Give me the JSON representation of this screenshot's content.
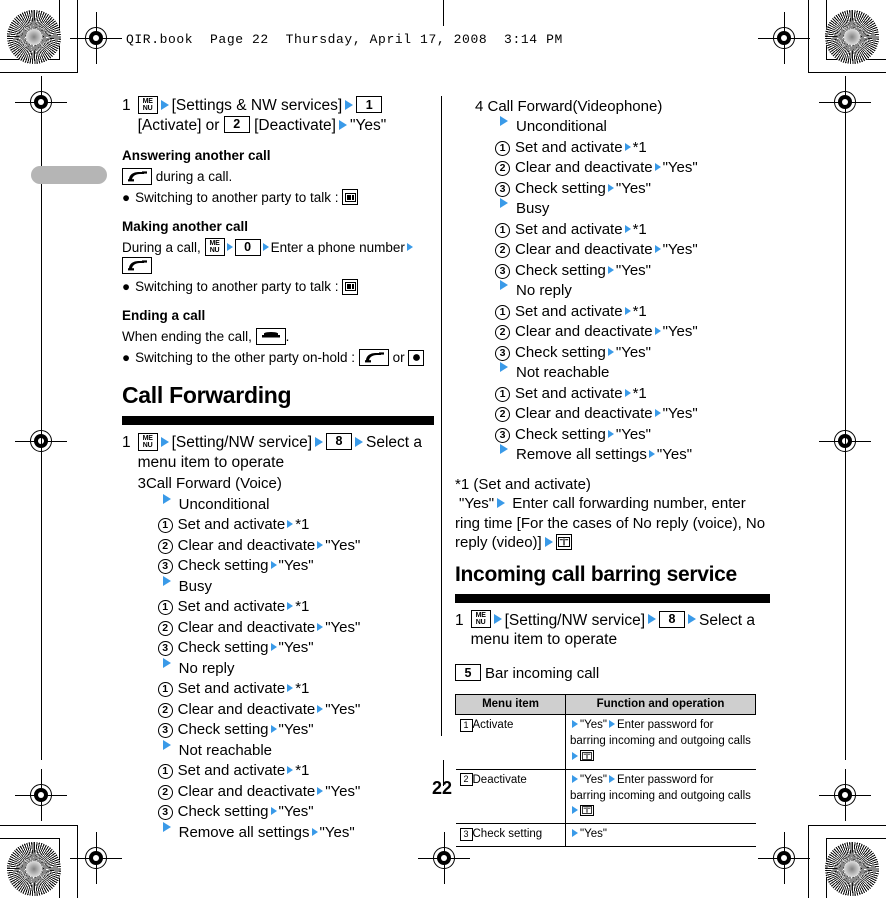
{
  "running_head": "QIR.book  Page 22  Thursday, April 17, 2008  3:14 PM",
  "page_number": "22",
  "colors": {
    "arrow_blue": "#3a9ae8",
    "table_header_gray": "#cfcfcf",
    "rule_black": "#000000",
    "margin_pill_gray": "#b5b5b5"
  },
  "left_column": {
    "step1": {
      "number": "1",
      "menu_key": "MENU",
      "part1": "[Settings & NW services]",
      "key1": "1",
      "part2": "[Activate] or",
      "key2": "2",
      "part3": "[Deactivate]",
      "result": "\"Yes\""
    },
    "answering": {
      "heading": "Answering another call",
      "line": "during a call.",
      "bullet": "Switching to another party to talk :"
    },
    "making": {
      "heading": "Making another call",
      "line_pre": "During a call,",
      "key0": "0",
      "line_mid": "Enter a phone number"
    },
    "ending": {
      "heading": "Ending a call",
      "line_pre": "When ending the call,",
      "line_post": ".",
      "bullet": "Switching to the other party on-hold :",
      "or": "or"
    },
    "section_title": "Call Forwarding",
    "step2": {
      "number": "1",
      "menu_key": "MENU",
      "part1": "[Setting/NW service]",
      "key1": "8",
      "part2": "Select a menu item to operate"
    },
    "voice_title": "3Call Forward (Voice)",
    "groups": [
      {
        "name": "Unconditional",
        "items": [
          {
            "n": "1",
            "label": "Set and activate",
            "value": "*1"
          },
          {
            "n": "2",
            "label": "Clear and deactivate",
            "value": "\"Yes\""
          },
          {
            "n": "3",
            "label": "Check setting",
            "value": "\"Yes\""
          }
        ]
      },
      {
        "name": "Busy",
        "items": [
          {
            "n": "1",
            "label": "Set and activate",
            "value": "*1"
          },
          {
            "n": "2",
            "label": "Clear and deactivate",
            "value": "\"Yes\""
          },
          {
            "n": "3",
            "label": "Check setting",
            "value": "\"Yes\""
          }
        ]
      },
      {
        "name": "No reply",
        "items": [
          {
            "n": "1",
            "label": "Set and activate",
            "value": "*1"
          },
          {
            "n": "2",
            "label": "Clear and deactivate",
            "value": "\"Yes\""
          },
          {
            "n": "3",
            "label": "Check setting",
            "value": "\"Yes\""
          }
        ]
      },
      {
        "name": "Not reachable",
        "items": [
          {
            "n": "1",
            "label": "Set and activate",
            "value": "*1"
          },
          {
            "n": "2",
            "label": "Clear and deactivate",
            "value": "\"Yes\""
          },
          {
            "n": "3",
            "label": "Check setting",
            "value": "\"Yes\""
          }
        ]
      }
    ],
    "remove_all": {
      "label": "Remove all settings",
      "value": "\"Yes\""
    }
  },
  "right_column": {
    "video_title": "4 Call Forward(Videophone)",
    "groups": [
      {
        "name": "Unconditional",
        "items": [
          {
            "n": "1",
            "label": "Set and activate",
            "value": "*1"
          },
          {
            "n": "2",
            "label": "Clear and deactivate",
            "value": "\"Yes\""
          },
          {
            "n": "3",
            "label": "Check setting",
            "value": "\"Yes\""
          }
        ]
      },
      {
        "name": "Busy",
        "items": [
          {
            "n": "1",
            "label": "Set and activate",
            "value": "*1"
          },
          {
            "n": "2",
            "label": "Clear and deactivate",
            "value": "\"Yes\""
          },
          {
            "n": "3",
            "label": "Check setting",
            "value": "\"Yes\""
          }
        ]
      },
      {
        "name": "No reply",
        "items": [
          {
            "n": "1",
            "label": "Set and activate",
            "value": "*1"
          },
          {
            "n": "2",
            "label": "Clear and deactivate",
            "value": "\"Yes\""
          },
          {
            "n": "3",
            "label": "Check setting",
            "value": "\"Yes\""
          }
        ]
      },
      {
        "name": "Not reachable",
        "items": [
          {
            "n": "1",
            "label": "Set and activate",
            "value": "*1"
          },
          {
            "n": "2",
            "label": "Clear and deactivate",
            "value": "\"Yes\""
          },
          {
            "n": "3",
            "label": "Check setting",
            "value": "\"Yes\""
          }
        ]
      }
    ],
    "remove_all": {
      "label": "Remove all settings",
      "value": "\"Yes\""
    },
    "footnote": {
      "title": "*1 (Set and activate)",
      "yes": "\"Yes\"",
      "body": "Enter call forwarding number, enter ring time [For the cases of No reply (voice), No reply (video)]"
    },
    "section_title": "Incoming call barring service",
    "step1": {
      "number": "1",
      "menu_key": "MENU",
      "part1": "[Setting/NW service]",
      "key1": "8",
      "part2": "Select a menu item to operate"
    },
    "bar_key": "5",
    "bar_label": "Bar incoming call",
    "table": {
      "headers": [
        "Menu item",
        "Function and operation"
      ],
      "rows": [
        {
          "key": "1",
          "item": "Activate",
          "yes": "\"Yes\"",
          "op": "Enter password for barring incoming and outgoing calls"
        },
        {
          "key": "2",
          "item": "Deactivate",
          "yes": "\"Yes\"",
          "op": "Enter password for barring incoming and outgoing calls"
        },
        {
          "key": "3",
          "item": "Check setting",
          "yes": "\"Yes\"",
          "op": ""
        }
      ]
    }
  }
}
